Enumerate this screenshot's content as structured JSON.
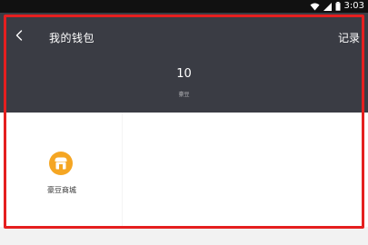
{
  "status_bar": {
    "time": "3:03"
  },
  "header": {
    "title": "我的钱包",
    "records_label": "记录",
    "balance_value": "10",
    "balance_label": "豪豆"
  },
  "grid": {
    "items": [
      {
        "label": "豪豆商城",
        "icon": "shop-icon"
      }
    ]
  },
  "colors": {
    "header_bg": "#3a3c44",
    "icon_orange": "#f5a623",
    "highlight_frame": "#e51f1f"
  }
}
